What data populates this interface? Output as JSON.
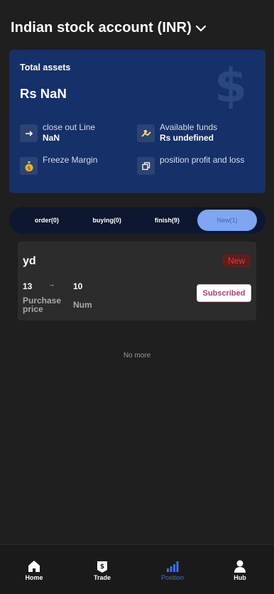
{
  "header": {
    "title": "Indian stock account (INR)",
    "dropdown_icon": "chevron-down-icon"
  },
  "assets": {
    "label": "Total assets",
    "value": "Rs NaN",
    "bg_symbol": "$",
    "close_out": {
      "label": "close out Line",
      "value": "NaN",
      "icon": "arrow-right-icon"
    },
    "available": {
      "label": "Available funds",
      "value": "Rs undefined",
      "icon": "hand-coin-icon"
    },
    "freeze": {
      "label": "Freeze Margin",
      "icon": "money-bag-icon"
    },
    "pnl": {
      "label": "position profit and loss",
      "icon": "copy-icon"
    }
  },
  "tabs": [
    {
      "label": "order(0)",
      "active": false
    },
    {
      "label": "buying(0)",
      "active": false
    },
    {
      "label": "finish(9)",
      "active": false
    },
    {
      "label": "New(1)",
      "active": true
    }
  ],
  "order": {
    "symbol": "yd",
    "status": "New",
    "price": "13",
    "arrow": "→",
    "num": "10",
    "price_label": "Purchase price",
    "num_label": "Num",
    "button": "Subscribed"
  },
  "footer_text": "No more",
  "nav": [
    {
      "label": "Home",
      "icon": "home-icon",
      "active": false
    },
    {
      "label": "Trade",
      "icon": "trade-icon",
      "active": false
    },
    {
      "label": "Position",
      "icon": "bar-chart-icon",
      "active": true
    },
    {
      "label": "Hub",
      "icon": "user-icon",
      "active": false
    }
  ],
  "colors": {
    "card": "#16306a",
    "accent": "#3d6fe0",
    "tab_active": "#7fa6f2",
    "badge": "#e03a3a"
  }
}
